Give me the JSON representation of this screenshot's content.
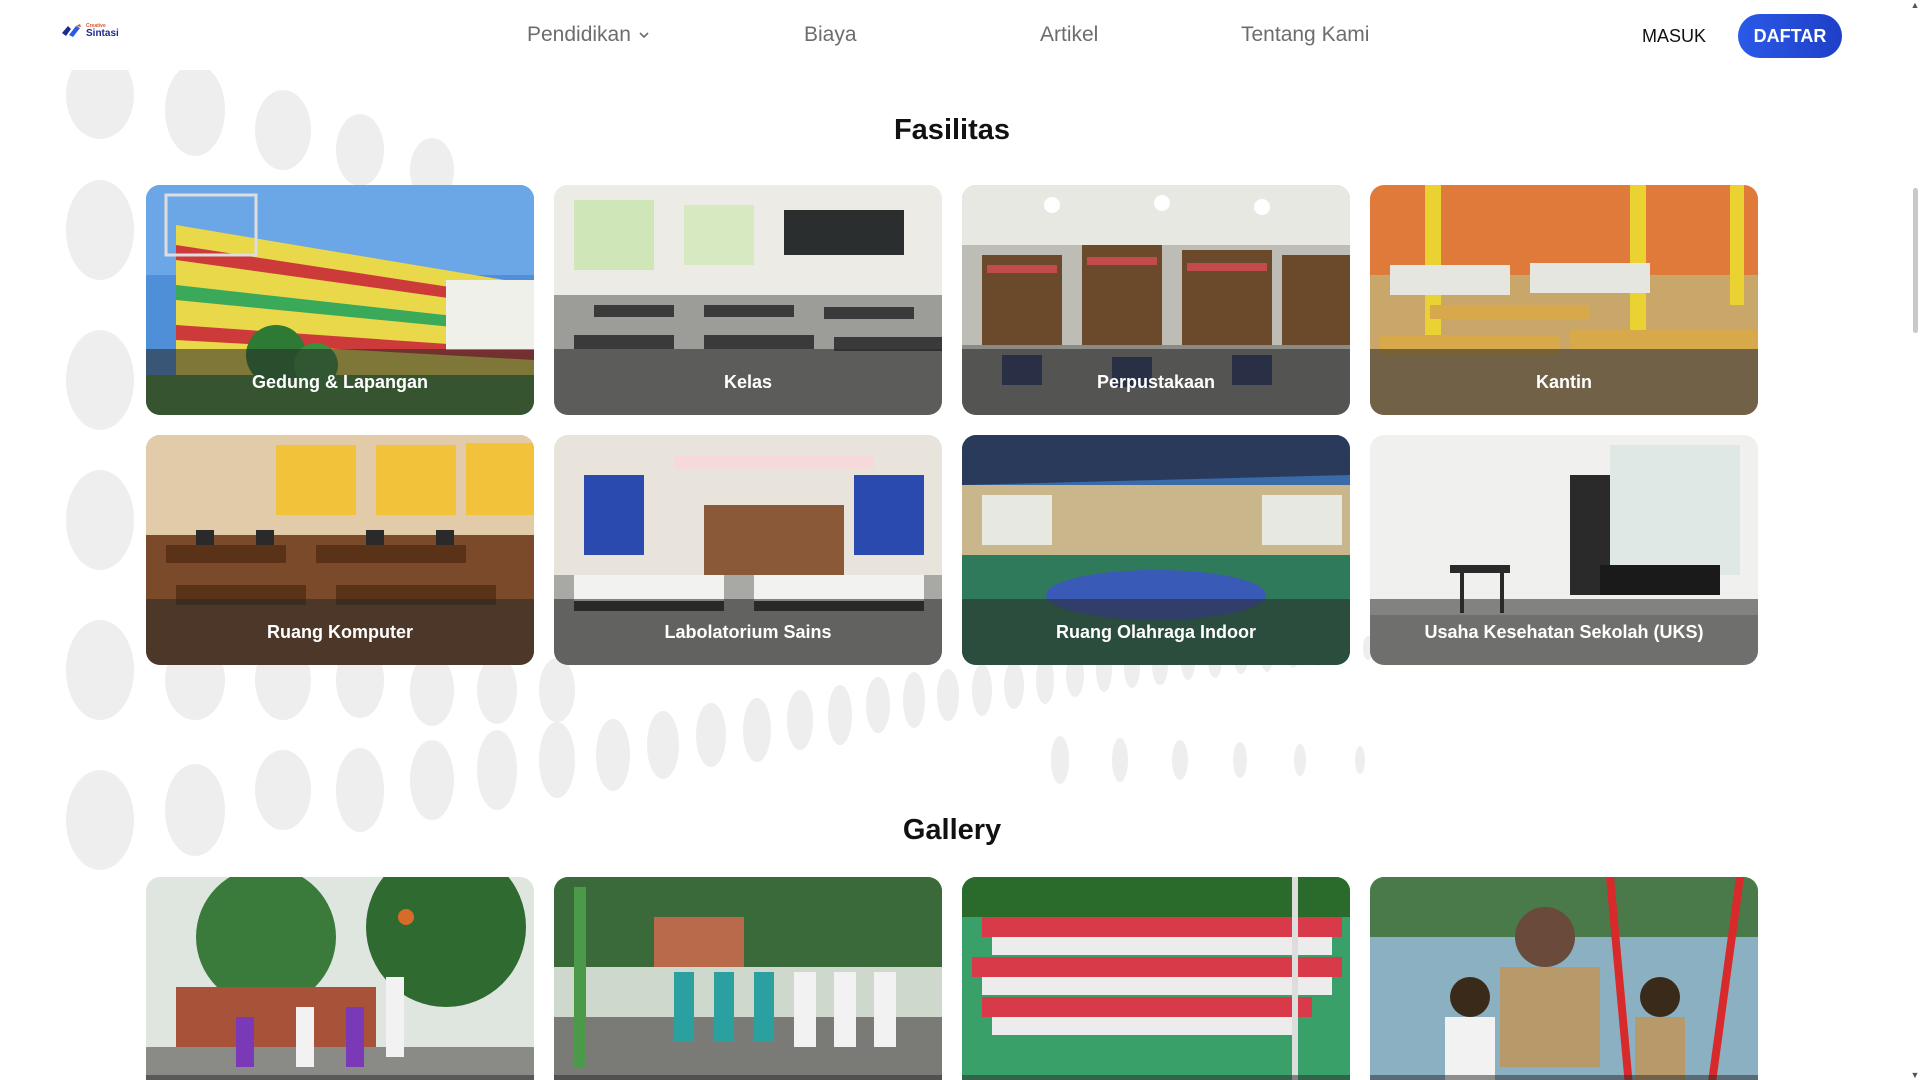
{
  "header": {
    "logo": {
      "small_text": "Creative",
      "big_text": "Sintasi"
    },
    "nav": [
      {
        "label": "Pendidikan",
        "has_dropdown": true
      },
      {
        "label": "Biaya"
      },
      {
        "label": "Artikel"
      },
      {
        "label": "Tentang Kami"
      }
    ],
    "login_label": "MASUK",
    "register_label": "DAFTAR"
  },
  "fasilitas": {
    "title": "Fasilitas",
    "items": [
      {
        "label": "Gedung & Lapangan"
      },
      {
        "label": "Kelas"
      },
      {
        "label": "Perpustakaan"
      },
      {
        "label": "Kantin"
      },
      {
        "label": "Ruang Komputer"
      },
      {
        "label": "Labolatorium Sains"
      },
      {
        "label": "Ruang Olahraga Indoor"
      },
      {
        "label": "Usaha Kesehatan Sekolah (UKS)"
      }
    ]
  },
  "gallery": {
    "title": "Gallery"
  },
  "colors": {
    "accent": "#2a5ae8",
    "text": "#111111",
    "nav_text": "#6d6d6d"
  }
}
